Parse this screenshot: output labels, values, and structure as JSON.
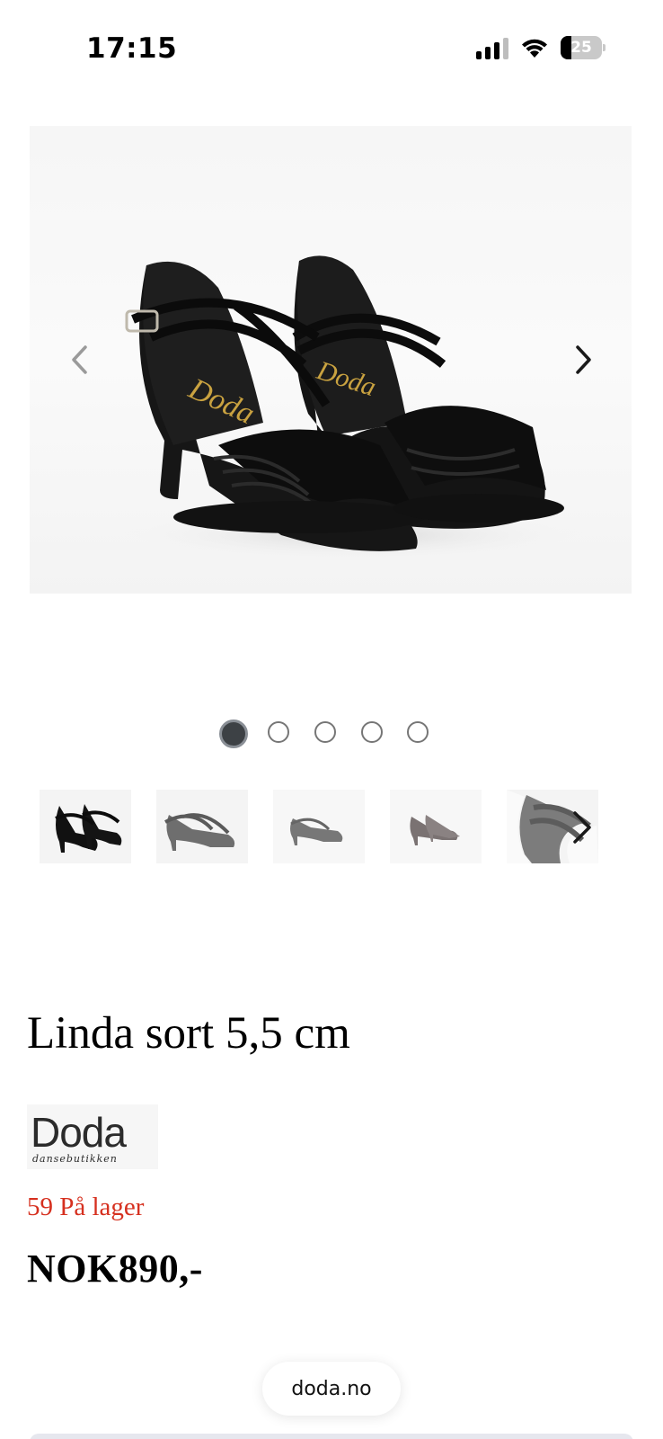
{
  "status_bar": {
    "time": "17:15",
    "battery_level": "25",
    "battery_fraction": 0.25,
    "icons": [
      "signal-icon",
      "wifi-icon",
      "battery-icon"
    ]
  },
  "gallery": {
    "main_image_alt": "Linda sort 5,5 cm",
    "prev_icon": "chevron-left-icon",
    "next_icon": "chevron-right-icon",
    "dot_count": 5,
    "active_dot": 1,
    "thumbnail_count": 5
  },
  "product": {
    "title": "Linda sort 5,5 cm",
    "brand_name": "Doda",
    "brand_sub": "dansebutikken",
    "stock": "59 På lager",
    "price": "NOK890,-"
  },
  "browser": {
    "url": "doda.no"
  },
  "colors": {
    "stock_red": "#d6301f",
    "active_dot": "#3d4145",
    "background": "#ffffff"
  }
}
